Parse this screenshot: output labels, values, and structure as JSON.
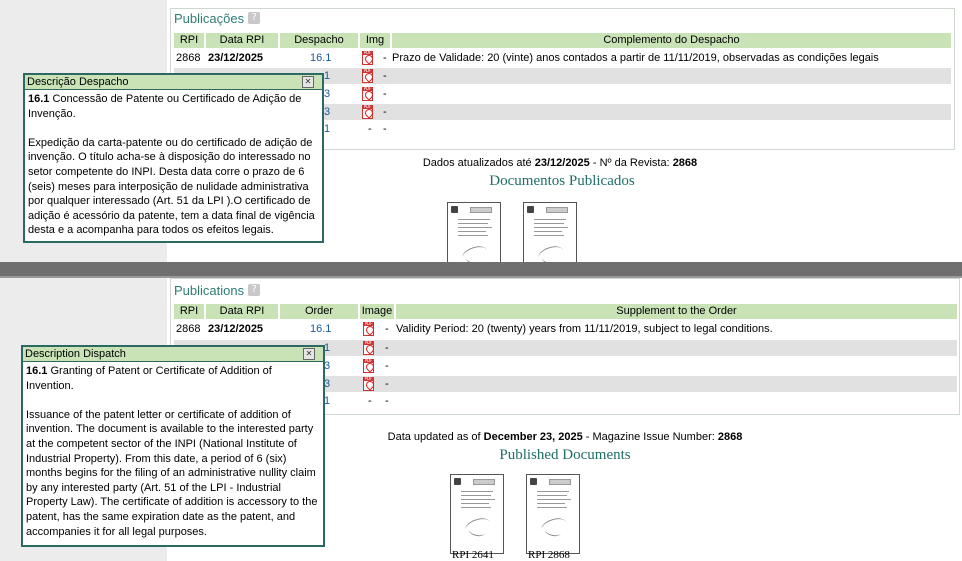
{
  "top": {
    "section_title": "Publicações",
    "help": "?",
    "headers": {
      "rpi": "RPI",
      "date": "Data RPI",
      "dispatch": "Despacho",
      "img": "Img",
      "complement": "Complemento do Despacho"
    },
    "rows": [
      {
        "rpi": "2868",
        "date": "23/12/2025",
        "dispatch": "16.1",
        "has_pdf": true,
        "dash": "-",
        "complement": "Prazo de Validade: 20 (vinte) anos contados a partir de 11/11/2019, observadas as condições legais"
      },
      {
        "dispatch": "1",
        "has_pdf": true,
        "dash": "-"
      },
      {
        "dispatch": "3",
        "has_pdf": true,
        "dash": "-"
      },
      {
        "dispatch": "3",
        "has_pdf": true,
        "dash": "-"
      },
      {
        "dispatch": "1",
        "has_pdf": false,
        "img_dash": "-",
        "dash": "-"
      }
    ],
    "updated_prefix": "Dados atualizados até ",
    "updated_date": "23/12/2025",
    "updated_mid": " - Nº da Revista: ",
    "updated_issue": "2868",
    "docs_title": "Documentos Publicados",
    "popup": {
      "title": "Descrição Despacho",
      "code": "16.1",
      "heading": " Concessão de Patente ou Certificado de Adição de Invenção.",
      "body": "Expedição da carta-patente ou do certificado de adição de invenção. O título acha-se à disposição do interessado no setor competente do INPI. Desta data corre o prazo de 6 (seis) meses para interposição de nulidade administrativa por qualquer interessado (Art. 51 da LPI ).O certificado de adição é acessório da patente, tem a data final de vigência desta e a acompanha para todos os efeitos legais."
    }
  },
  "bottom": {
    "section_title": "Publications",
    "help": "?",
    "headers": {
      "rpi": "RPI",
      "date": "Data RPI",
      "dispatch": "Order",
      "img": "Image",
      "complement": "Supplement to the Order"
    },
    "rows": [
      {
        "rpi": "2868",
        "date": "23/12/2025",
        "dispatch": "16.1",
        "has_pdf": true,
        "dash": "-",
        "complement": "Validity Period: 20 (twenty) years from 11/11/2019, subject to legal conditions."
      },
      {
        "dispatch": "1",
        "has_pdf": true,
        "dash": "-"
      },
      {
        "dispatch": "3",
        "has_pdf": true,
        "dash": "-"
      },
      {
        "dispatch": "3",
        "has_pdf": true,
        "dash": "-"
      },
      {
        "dispatch": "1",
        "has_pdf": false,
        "img_dash": "-",
        "dash": "-"
      }
    ],
    "updated_prefix": "Data updated as of ",
    "updated_date": "December 23, 2025",
    "updated_mid": " - Magazine Issue Number: ",
    "updated_issue": "2868",
    "docs_title": "Published Documents",
    "doc_captions": [
      "RPI 2641",
      "RPI 2868"
    ],
    "popup": {
      "title": "Description Dispatch",
      "code": "16.1",
      "heading": " Granting of Patent or Certificate of Addition of Invention.",
      "body": "Issuance of the patent letter or certificate of addition of invention. The document is available to the interested party at the competent sector of the INPI (National Institute of Industrial Property). From this date, a period of 6 (six) months begins for the filing of an administrative nullity claim by any interested party (Art. 51 of the LPI - Industrial Property Law). The certificate of addition is accessory to the patent, has the same expiration date as the patent, and accompanies it for all legal purposes."
    }
  },
  "colors": {
    "accent": "#2e7d74",
    "header_bg": "#c9e3b7",
    "row_gray": "#e1e1e1",
    "link": "#1a5aa0"
  }
}
